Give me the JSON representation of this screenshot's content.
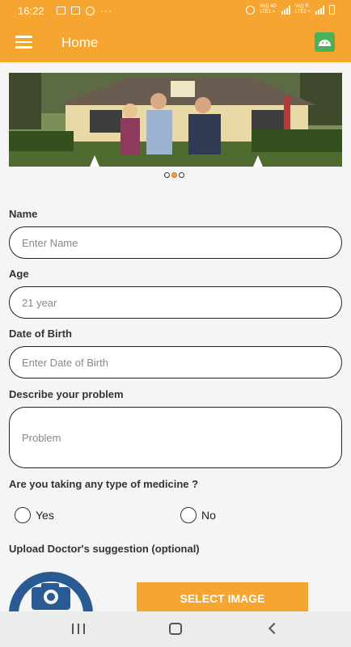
{
  "status_bar": {
    "time": "16:22",
    "dots": "···",
    "network1": "Vo)) 4G",
    "network1_sub": "LTE1 +",
    "network2": "Vo)) R",
    "network2_sub": "LTE2 +"
  },
  "app_bar": {
    "title": "Home",
    "menu_icon": "hamburger-menu-icon",
    "action_icon": "android-icon"
  },
  "carousel": {
    "slide_count": 3,
    "active_index": 1
  },
  "form": {
    "name_label": "Name",
    "name_placeholder": "Enter Name",
    "age_label": "Age",
    "age_value": "21 year",
    "dob_label": "Date of Birth",
    "dob_placeholder": "Enter Date of Birth",
    "problem_label": "Describe your problem",
    "problem_placeholder": "Problem",
    "medicine_question": "Are you taking any type of medicine ?",
    "yes_label": "Yes",
    "no_label": "No",
    "upload_label": "Upload Doctor's suggestion (optional)",
    "select_image_button": "SELECT IMAGE"
  },
  "colors": {
    "accent": "#f7a531",
    "camera_blue": "#2a5a93",
    "android_green": "#4bb05a"
  }
}
